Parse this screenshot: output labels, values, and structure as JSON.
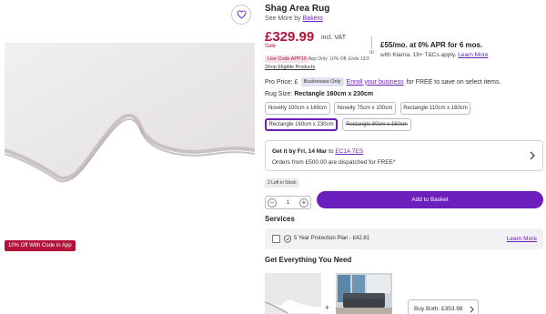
{
  "product": {
    "title": "Shag Area Rug",
    "see_more_prefix": "See More by",
    "brand": "Bakero",
    "price": "£329.99",
    "vat": "incl. VAT",
    "sale_label": "Sale",
    "or_label": "or",
    "klarna_main": "£55/mo. at 0% APR for 6 mos.",
    "klarna_sub": "with Klarna. 18+ T&Cs apply.",
    "klarna_learn_more": "Learn More",
    "code_badge": "Use Code APP10",
    "app_only_text": "App Only: 10% Off, Ends 13/3",
    "shop_eligible": "Shop Eligible Products",
    "pro_price_label": "Pro Price: £",
    "businesses_only": "Businesses Only",
    "enroll_link": "Enroll your business",
    "pro_price_suffix": "for FREE to save on select items."
  },
  "media": {
    "app_badge": "10% Off With Code in App",
    "wishlist_icon": "heart-icon"
  },
  "rug_size": {
    "label": "Rug Size:",
    "selected": "Rectangle 160cm x 230cm",
    "options": [
      {
        "label": "Novelty 100cm x 160cm"
      },
      {
        "label": "Novelty 75cm x 100cm"
      },
      {
        "label": "Rectangle 110cm x 160cm"
      },
      {
        "label": "Rectangle 160cm x 230cm",
        "selected": true
      },
      {
        "label": "Rectangle 80cm x 160cm",
        "unavailable": true
      }
    ]
  },
  "delivery": {
    "get_it": "Get it by Fri, 14 Mar",
    "to_text": "to",
    "postcode": "EC1A 7ES",
    "orders_text": "Orders from £500.00 are dispatched for FREE*"
  },
  "stock": "2 Left in Stock",
  "purchase": {
    "quantity": "1",
    "add_to_basket": "Add to Basket"
  },
  "services": {
    "heading": "Services",
    "protection_plan": "5 Year Protection Plan - £42.81",
    "learn_more": "Learn More"
  },
  "bundle": {
    "heading": "Get Everything You Need",
    "plus": "+",
    "buy_both": "Buy Both: £353.98"
  },
  "colors": {
    "accent": "#6b1fbd",
    "sale_red": "#b3123b"
  }
}
